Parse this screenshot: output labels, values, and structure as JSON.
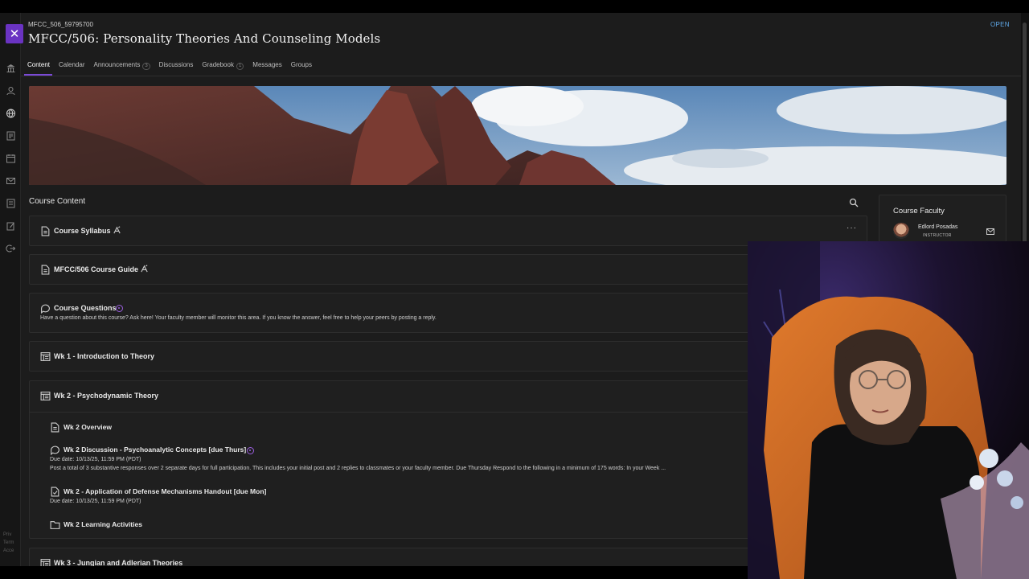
{
  "course": {
    "id": "MFCC_506_59795700",
    "title": "MFCC/506: Personality Theories And Counseling Models",
    "status": "OPEN"
  },
  "tabs": [
    {
      "label": "Content",
      "count": ""
    },
    {
      "label": "Calendar",
      "count": ""
    },
    {
      "label": "Announcements",
      "count": "3"
    },
    {
      "label": "Discussions",
      "count": ""
    },
    {
      "label": "Gradebook",
      "count": "1"
    },
    {
      "label": "Messages",
      "count": ""
    },
    {
      "label": "Groups",
      "count": ""
    }
  ],
  "content": {
    "heading": "Course Content",
    "items": [
      {
        "label": "Course Syllabus",
        "icon": "document-icon"
      },
      {
        "label": "MFCC/506 Course Guide",
        "icon": "document-icon"
      },
      {
        "label": "Course Questions",
        "icon": "discussion-icon",
        "description": "Have a question about this course? Ask here! Your faculty member will monitor this area. If you know the answer, feel free to help your peers by posting a reply."
      },
      {
        "label": "Wk 1 - Introduction to Theory",
        "icon": "learning-module-icon"
      },
      {
        "label": "Wk 2 - Psychodynamic Theory",
        "icon": "learning-module-icon",
        "children": [
          {
            "label": "Wk 2 Overview",
            "icon": "document-icon"
          },
          {
            "label": "Wk 2 Discussion - Psychoanalytic Concepts [due Thurs]",
            "icon": "discussion-icon",
            "due": "Due date: 10/13/25, 11:59 PM (PDT)",
            "description": "Post a total of 3 substantive responses over 2 separate days for full participation. This includes your initial post and 2 replies to classmates or your faculty member. Due Thursday Respond to the following in a minimum of 175 words: In your Week ..."
          },
          {
            "label": "Wk 2 - Application of Defense Mechanisms Handout [due Mon]",
            "icon": "assignment-icon",
            "due": "Due date: 10/13/25, 11:59 PM (PDT)"
          },
          {
            "label": "Wk 2 Learning Activities",
            "icon": "folder-icon"
          }
        ]
      },
      {
        "label": "Wk 3 - Jungian and Adlerian Theories",
        "icon": "learning-module-icon"
      }
    ]
  },
  "faculty": {
    "title": "Course Faculty",
    "name": "Edlord Posadas",
    "role": "INSTRUCTOR"
  },
  "footer_legal": [
    "Priv",
    "Term",
    "Acce"
  ],
  "colors": {
    "accent": "#6a33c2",
    "background": "#1c1c1c",
    "open_badge": "#5fa8e8"
  }
}
